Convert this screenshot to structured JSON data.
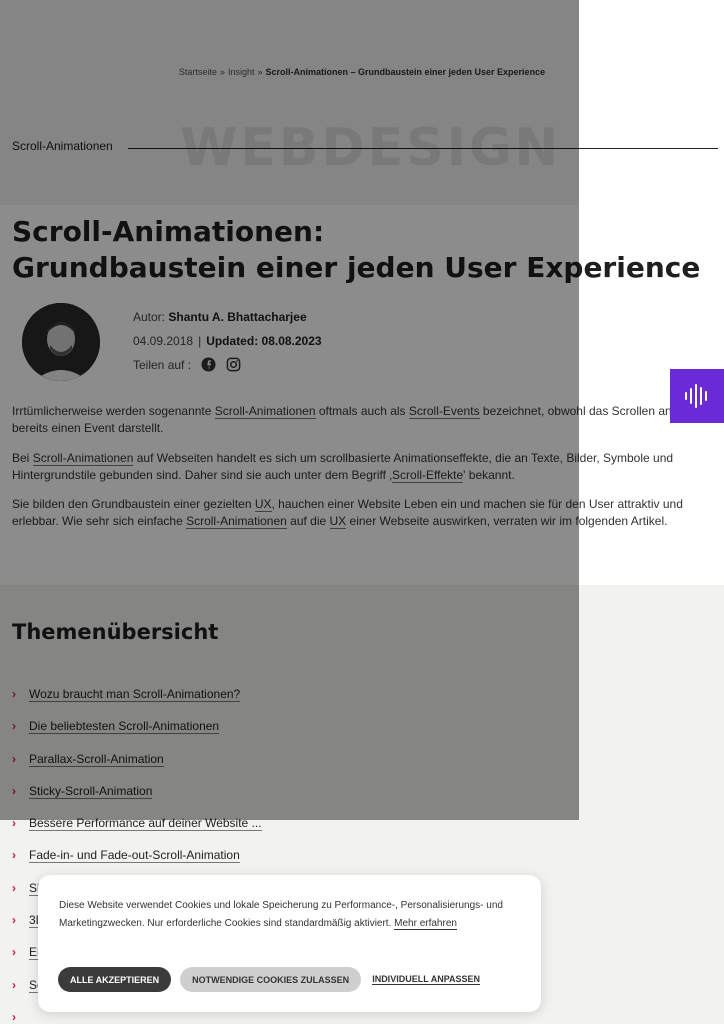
{
  "breadcrumb": {
    "items": [
      "Startseite",
      "Insight"
    ],
    "separator": "»",
    "current": "Scroll-Animationen – Grundbaustein einer jeden User Experience"
  },
  "category": {
    "watermark": "WEBDESIGN",
    "label": "Scroll-Animationen"
  },
  "article": {
    "title_line1": "Scroll-Animationen:",
    "title_line2": "Grundbaustein einer jeden User Experience",
    "author_label": "Autor:",
    "author_name": "Shantu A. Bhattacharjee",
    "date": "04.09.2018",
    "date_divider": "|",
    "updated": "Updated: 08.08.2023",
    "share_label": "Teilen auf :"
  },
  "intro": {
    "p1": {
      "t1": "Irrtümlicherweise werden sogenannte ",
      "l1": "Scroll-Animationen",
      "t2": " oftmals auch als ",
      "l2": "Scroll-Events",
      "t3": " bezeichnet, obwohl das Scrollen an sich bereits einen Event darstellt."
    },
    "p2": {
      "t1": "Bei ",
      "l1": "Scroll-Animationen",
      "t2": " auf Webseiten handelt es sich um scrollbasierte Animationseffekte, die an Texte, Bilder, Symbole und Hintergrundstile gebunden sind. Daher sind sie auch unter dem Begriff ‚",
      "l2": "Scroll-Effekte",
      "t3": "' bekannt."
    },
    "p3": {
      "t1": "Sie bilden den Grundbaustein einer gezielten ",
      "l1": "UX",
      "t2": ", hauchen einer Website Leben ein und machen sie für den User attraktiv und erlebbar. Wie sehr sich einfache ",
      "l2": "Scroll-Animationen",
      "t3": " auf die ",
      "l3": "UX",
      "t4": " einer Webseite auswirken, verraten wir im folgenden Artikel."
    }
  },
  "toc": {
    "title": "Themenübersicht",
    "items": [
      "Wozu braucht man Scroll-Animationen?",
      "Die beliebtesten Scroll-Animationen",
      "Parallax-Scroll-Animation",
      "Sticky-Scroll-Animation",
      "Bessere Performance auf deiner Website ...",
      "Fade-in- und Fade-out-Scroll-Animation",
      "Sl",
      "3D",
      "Er",
      "Sc",
      ""
    ]
  },
  "cookie": {
    "text": "Diese Website verwendet Cookies und lokale Speicherung zu Performance-, Personalisierungs- und Marketingzwecken. Nur erforderliche Cookies sind standardmäßig aktiviert.",
    "link": "Mehr erfahren",
    "accept": "ALLE AKZEPTIEREN",
    "necessary": "NOTWENDIGE COOKIES ZULASSEN",
    "custom": "INDIVIDUELL ANPASSEN"
  },
  "icons": {
    "share": [
      "facebook-icon",
      "instagram-icon"
    ],
    "chevron": "›",
    "accessibility": "audio-wave-icon"
  },
  "colors": {
    "accent_magenta": "#d4145a",
    "accessibility_purple": "#6a2ad6",
    "toc_background": "#f2f2f0"
  }
}
